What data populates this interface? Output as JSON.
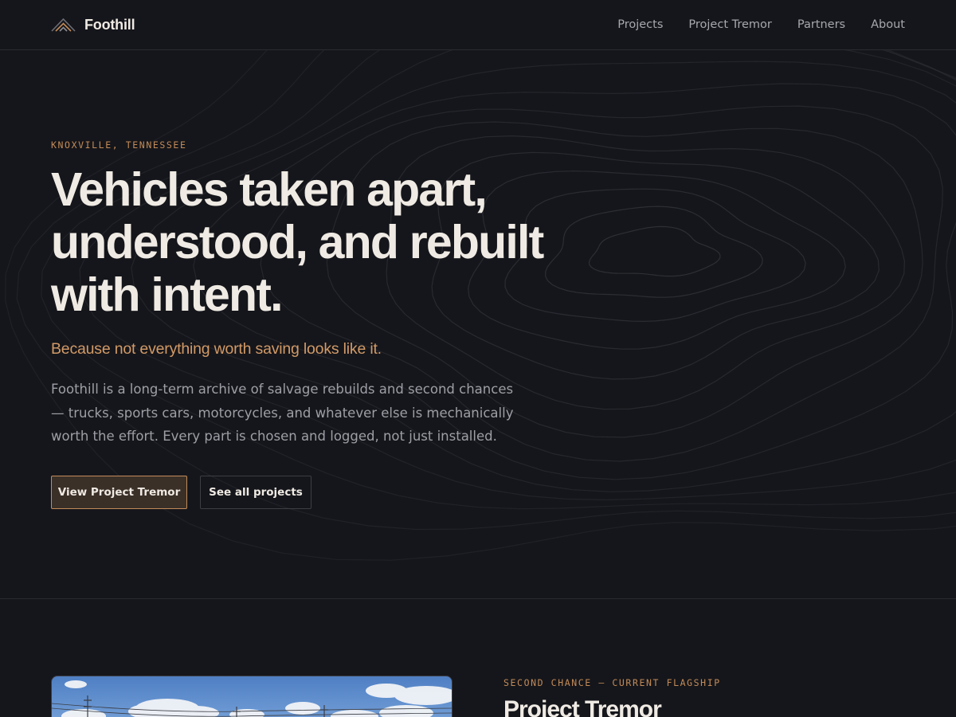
{
  "header": {
    "brand": "Foothill",
    "nav": [
      "Projects",
      "Project Tremor",
      "Partners",
      "About"
    ]
  },
  "hero": {
    "eyebrow": "KNOXVILLE, TENNESSEE",
    "headline_lines": [
      "Vehicles taken apart,",
      "understood, and rebuilt",
      "with intent."
    ],
    "tagline": "Because not everything worth saving looks like it.",
    "lede_lines": [
      "Foothill is a long-term archive of salvage rebuilds and second chances",
      "— trucks, sports cars, motorcycles, and whatever else is mechanically",
      "worth the effort. Every part is chosen and logged, not just installed."
    ],
    "primary_cta": "View Project Tremor",
    "secondary_cta": "See all projects"
  },
  "feature": {
    "eyebrow": "SECOND CHANCE — CURRENT FLAGSHIP",
    "title": "Project Tremor"
  },
  "colors": {
    "background": "#15161b",
    "text": "#efeae3",
    "accent": "#c38b58",
    "muted": "#9e9fa6",
    "divider": "#2a2b31"
  },
  "icons": {
    "logo": "mountain-peaks-icon"
  }
}
